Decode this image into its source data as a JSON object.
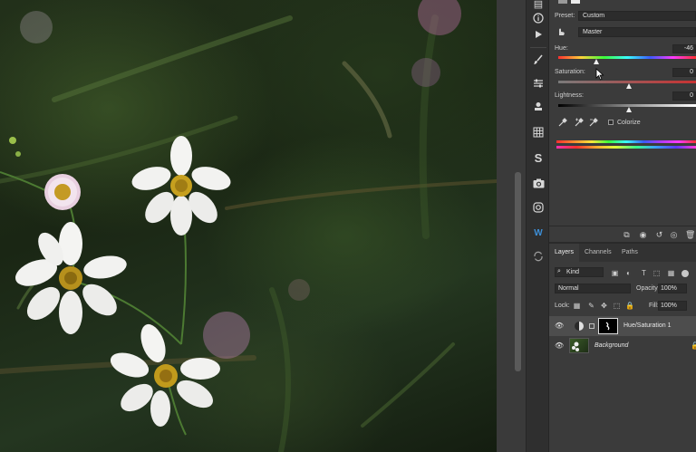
{
  "properties": {
    "preset_label": "Preset:",
    "preset_value": "Custom",
    "channel_value": "Master",
    "hue_label": "Hue:",
    "hue_value": "-46",
    "saturation_label": "Saturation:",
    "saturation_value": "0",
    "lightness_label": "Lightness:",
    "lightness_value": "0",
    "colorize_label": "Colorize"
  },
  "layers_panel": {
    "tabs": [
      "Layers",
      "Channels",
      "Paths"
    ],
    "filter_kind": "Kind",
    "blend_mode": "Normal",
    "opacity_label": "Opacity:",
    "opacity_value": "100%",
    "lock_label": "Lock:",
    "fill_label": "Fill:",
    "fill_value": "100%",
    "layers": [
      {
        "name": "Hue/Saturation 1",
        "selected": true
      },
      {
        "name": "Background",
        "selected": false
      }
    ]
  },
  "colors": {
    "panel_bg": "#3b3b3b",
    "toolbar_bg": "#2f2f2f",
    "selected_layer": "#4d4d4d"
  },
  "icons": [
    "ruler-icon",
    "info-icon",
    "play-icon",
    "brush-icon",
    "adjustments-icon",
    "stamp-icon",
    "grid-icon",
    "s-icon",
    "camera-icon",
    "instagram-icon",
    "w-icon",
    "sync-icon"
  ]
}
